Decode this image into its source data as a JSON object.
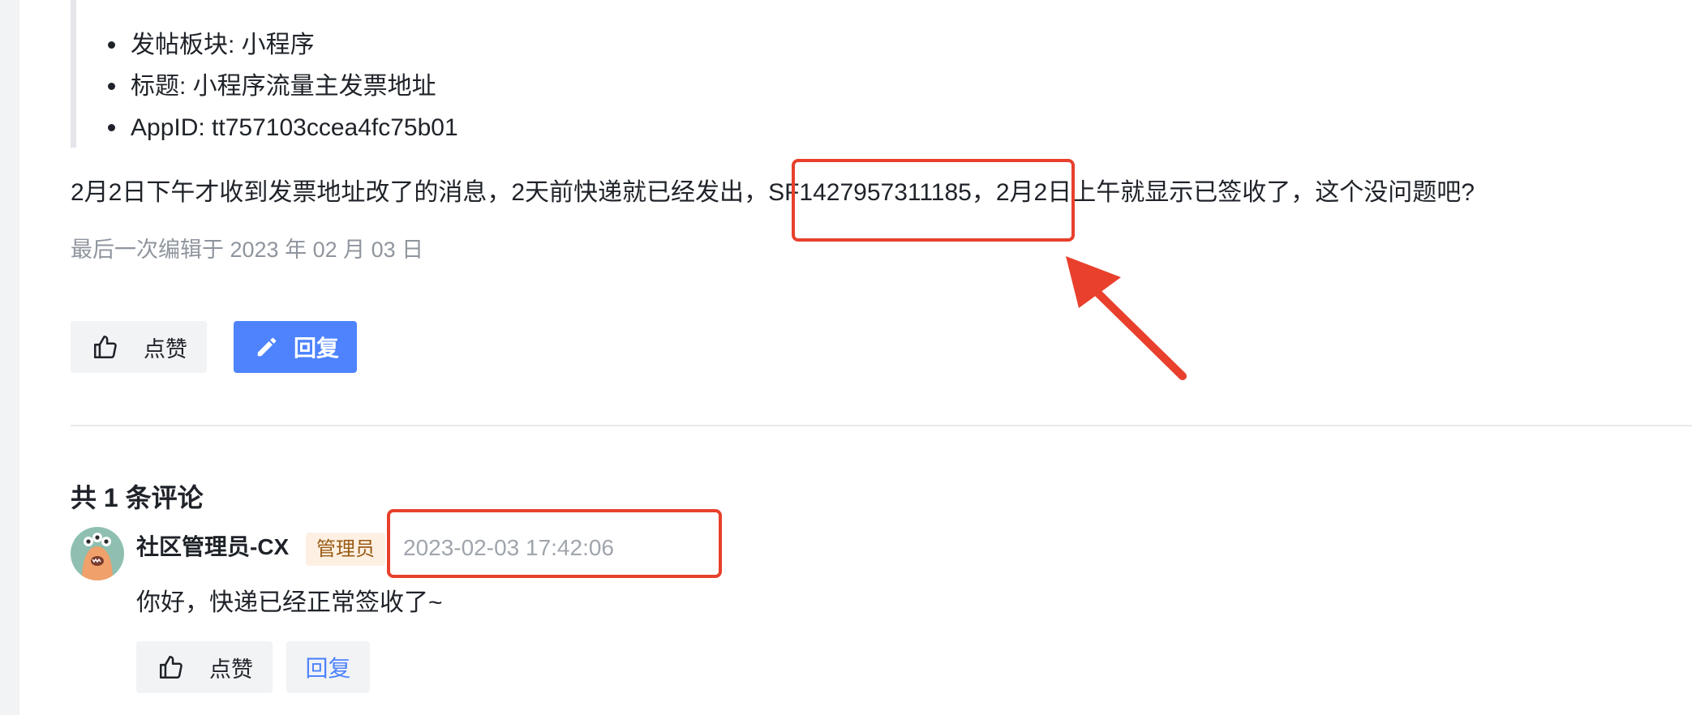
{
  "post": {
    "info_items": [
      "发帖板块: 小程序",
      "标题: 小程序流量主发票地址",
      "AppID: tt757103ccea4fc75b01"
    ],
    "body_before": "2月2日下午才收到发票地址改了的消息，2天前快递就已经发出",
    "body_comma": "，",
    "tracking_number": "SF1427957311185",
    "body_after": "，2月2日上午就显示已签收了，这个没问题吧?",
    "edited_note": "最后一次编辑于 2023 年 02 月 03 日",
    "like_label": "点赞",
    "reply_label": "回复"
  },
  "comments": {
    "heading": "共 1 条评论",
    "items": [
      {
        "author": "社区管理员-CX",
        "badge": "管理员",
        "time": "2023-02-03 17:42:06",
        "text": "你好，快递已经正常签收了~",
        "like_label": "点赞",
        "reply_label": "回复"
      }
    ]
  },
  "colors": {
    "accent": "#4e83fd",
    "annotation": "#e8402c",
    "badge_bg": "#fdf0e3",
    "badge_text": "#9a5b13",
    "muted_text": "#8f959e"
  },
  "icons": {
    "like": "thumbs-up-icon",
    "reply": "pencil-icon",
    "annotation_arrow": "arrow-icon"
  }
}
